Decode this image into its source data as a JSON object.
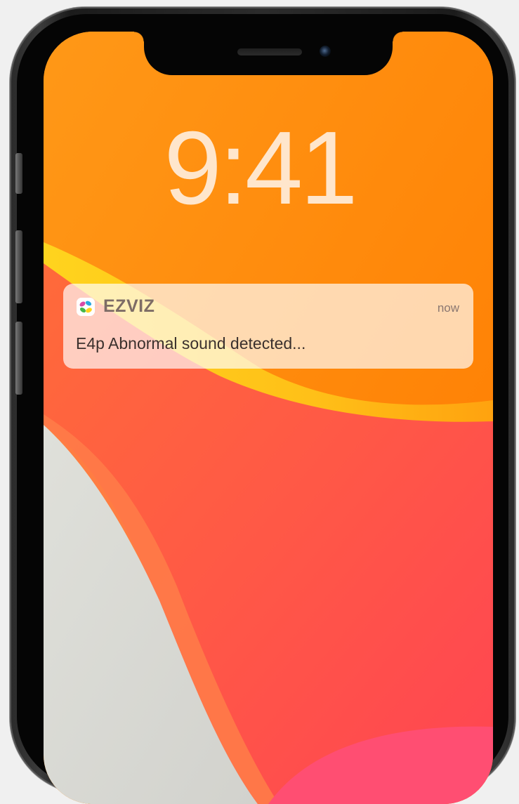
{
  "lock_screen": {
    "time": "9:41"
  },
  "notification": {
    "app_name": "EZVIZ",
    "time": "now",
    "message": "E4p Abnormal sound detected...",
    "app_icon": "ezviz-logo-icon"
  },
  "colors": {
    "wallpaper_orange": "#ff8b0a",
    "wallpaper_red": "#ff4c4c",
    "wallpaper_yellow": "#ffcf1f",
    "wallpaper_gray": "#d9d9d4",
    "clock_text": "#ffeedc"
  }
}
